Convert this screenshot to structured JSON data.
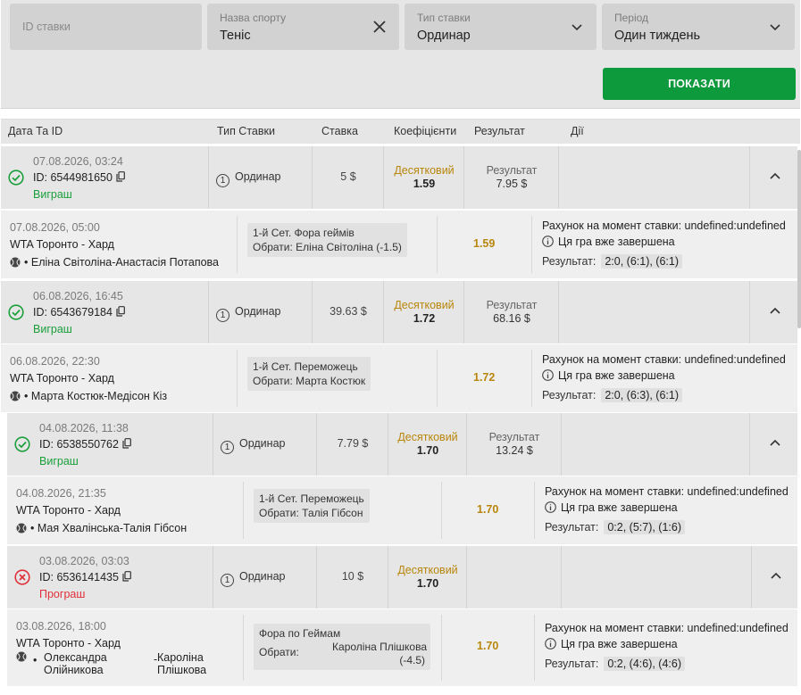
{
  "filters": {
    "bet_id": {
      "placeholder": "ID ставки"
    },
    "sport": {
      "label": "Назва спорту",
      "value": "Теніс"
    },
    "bet_type": {
      "label": "Тип ставки",
      "value": "Ординар"
    },
    "period": {
      "label": "Період",
      "value": "Один тиждень"
    },
    "show_button": "ПОКАЗАТИ"
  },
  "table_header": [
    "Дата Та ID",
    "Тип Ставки",
    "Ставка",
    "Коефіцієнти",
    "Результат",
    "Дії"
  ],
  "colors": {
    "win": "#1a9f3b",
    "lose": "#e0303a",
    "accent_green": "#0d9a3c",
    "coef_gold": "#b8860b"
  },
  "bets": [
    {
      "date": "07.08.2026, 03:24",
      "id": "ID: 6544981650",
      "outcome": "Виграш",
      "status": "win",
      "type_num": "1",
      "type": "Ординар",
      "stake": "5 $",
      "coef_type": "Десятковий",
      "coef": "1.59",
      "result_label": "Результат",
      "result_value": "7.95 $",
      "detail": {
        "date": "07.08.2026, 05:00",
        "tournament": "WTA Торонто - Хард",
        "match": "Еліна Світоліна-Анастасія Потапова",
        "market": "1-й Сет. Фора геймів",
        "pick": "Обрати: Еліна Світоліна (-1.5)",
        "coef": "1.59",
        "account": "Рахунок на момент ставки: undefined:undefined",
        "finished": "Ця гра вже завершена",
        "result_label": "Результат:",
        "score": "2:0, (6:1), (6:1)"
      }
    },
    {
      "date": "06.08.2026, 16:45",
      "id": "ID: 6543679184",
      "outcome": "Виграш",
      "status": "win",
      "type_num": "1",
      "type": "Ординар",
      "stake": "39.63 $",
      "coef_type": "Десятковий",
      "coef": "1.72",
      "result_label": "Результат",
      "result_value": "68.16 $",
      "detail": {
        "date": "06.08.2026, 22:30",
        "tournament": "WTA Торонто - Хард",
        "match": "Марта Костюк-Медісон Кіз",
        "market": "1-й Сет. Переможець",
        "pick": "Обрати: Марта Костюк",
        "coef": "1.72",
        "account": "Рахунок на момент ставки: undefined:undefined",
        "finished": "Ця гра вже завершена",
        "result_label": "Результат:",
        "score": "2:0, (6:3), (6:1)"
      }
    },
    {
      "date": "04.08.2026, 11:38",
      "id": "ID: 6538550762",
      "outcome": "Виграш",
      "status": "win",
      "type_num": "1",
      "type": "Ординар",
      "stake": "7.79 $",
      "coef_type": "Десятковий",
      "coef": "1.70",
      "result_label": "Результат",
      "result_value": "13.24 $",
      "detail": {
        "date": "04.08.2026, 21:35",
        "tournament": "WTA Торонто - Хард",
        "match": "Мая Хвалінська-Талія Гібсон",
        "market": "1-й Сет. Переможець",
        "pick": "Обрати: Талія Гібсон",
        "coef": "1.70",
        "account": "Рахунок на момент ставки: undefined:undefined",
        "finished": "Ця гра вже завершена",
        "result_label": "Результат:",
        "score": "0:2, (5:7), (1:6)"
      }
    },
    {
      "date": "03.08.2026, 03:03",
      "id": "ID: 6536141435",
      "outcome": "Програш",
      "status": "lose",
      "type_num": "1",
      "type": "Ординар",
      "stake": "10 $",
      "coef_type": "Десятковий",
      "coef": "1.70",
      "detail": {
        "date": "03.08.2026, 18:00",
        "tournament": "WTA Торонто - Хард",
        "player1_line1": "Олександра",
        "player1_line2": "Олійникова",
        "dash": "-",
        "player2_line1": "Кароліна",
        "player2_line2": "Плішкова",
        "market": "Фора по Геймам",
        "pick_label": "Обрати:",
        "pick_value_line1": "Кароліна Плішкова",
        "pick_value_line2": "(-4.5)",
        "coef": "1.70",
        "account": "Рахунок на момент ставки: undefined:undefined",
        "finished": "Ця гра вже завершена",
        "result_label": "Результат:",
        "score": "0:2, (4:6), (4:6)"
      }
    }
  ]
}
